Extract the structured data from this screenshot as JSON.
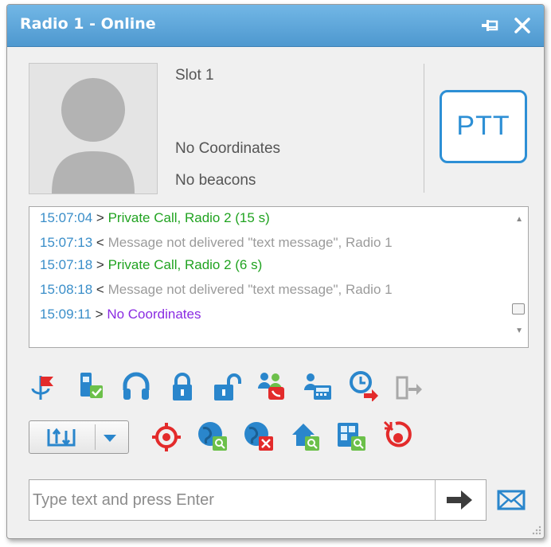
{
  "window": {
    "title": "Radio 1 - Online"
  },
  "titlebar": {
    "pin_icon": "pin-icon",
    "close_icon": "close-icon"
  },
  "radio": {
    "slot": "Slot 1",
    "coordinates": "No Coordinates",
    "beacons": "No beacons"
  },
  "ptt": {
    "label": "PTT"
  },
  "log": {
    "lines": [
      {
        "time": "15:07:04",
        "dir": ">",
        "text": "Private Call, Radio 2 (15 s)",
        "color": "#21a321"
      },
      {
        "time": "15:07:13",
        "dir": "<",
        "text": "Message not delivered \"text message\", Radio 1",
        "color": "#9b9b9b"
      },
      {
        "time": "15:07:18",
        "dir": ">",
        "text": "Private Call, Radio 2 (6 s)",
        "color": "#21a321"
      },
      {
        "time": "15:08:18",
        "dir": "<",
        "text": "Message not delivered \"text message\", Radio 1",
        "color": "#9b9b9b"
      },
      {
        "time": "15:09:11",
        "dir": ">",
        "text": "No Coordinates",
        "color": "#8a2be2"
      }
    ]
  },
  "toolbar": {
    "row1": [
      "location-flag-icon",
      "radio-check-icon",
      "headset-icon",
      "lock-icon",
      "unlock-icon",
      "call-contacts-icon",
      "phone-directory-icon",
      "scheduled-forward-icon",
      "exit-icon"
    ],
    "row2": [
      "transfer-split-icon",
      "locate-target-icon",
      "globe-search-icon",
      "globe-remove-icon",
      "home-search-icon",
      "map-search-icon",
      "tracking-stop-icon"
    ]
  },
  "composer": {
    "placeholder": "Type text and press Enter",
    "send_icon": "send-arrow-icon",
    "mail_icon": "envelope-icon"
  },
  "colors": {
    "accent": "#2d8fd5",
    "titlebar": "#5aa6dc"
  }
}
